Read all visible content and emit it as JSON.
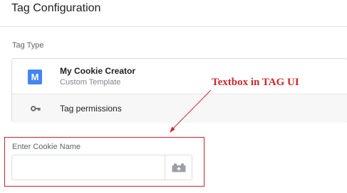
{
  "header": {
    "title": "Tag Configuration"
  },
  "tag_type": {
    "section_label": "Tag Type",
    "template": {
      "badge_letter": "M",
      "badge_color": "#4285f4",
      "name": "My Cookie Creator",
      "subtitle": "Custom Template"
    },
    "permissions": {
      "icon": "key-icon",
      "label": "Tag permissions"
    }
  },
  "cookie_field": {
    "label": "Enter Cookie Name",
    "value": "",
    "placeholder": "",
    "variable_button_icon": "variable-brick-icon"
  },
  "annotation": {
    "text": "Textbox in TAG UI",
    "color": "#d0262c"
  }
}
